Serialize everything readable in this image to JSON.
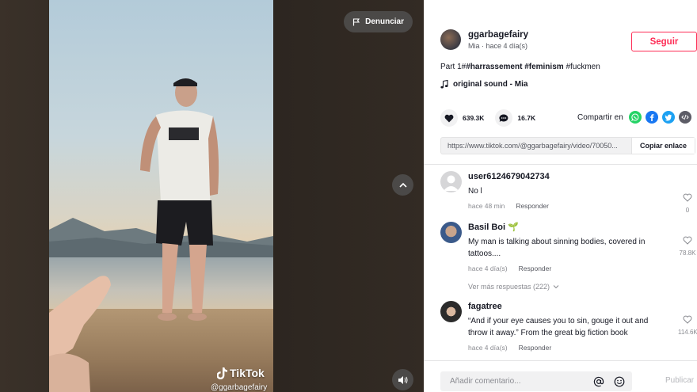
{
  "video": {
    "report_label": "Denunciar",
    "brand": "TikTok",
    "watermark_handle": "@ggarbagefairy",
    "player_icons": [
      "flag-icon",
      "chevron-up-icon",
      "volume-icon"
    ]
  },
  "author": {
    "username": "ggarbagefairy",
    "subtitle": "Mia · hace 4 día(s)",
    "follow_label": "Seguir"
  },
  "caption": {
    "prefix": "Part 1#",
    "tags_bold": [
      "#harrassement",
      "#feminism"
    ],
    "tag_plain": "#fuckmen"
  },
  "sound": {
    "label": "original sound - Mia"
  },
  "stats": {
    "likes": "639.3K",
    "comments": "16.7K",
    "share_label": "Compartir en",
    "share_icons": [
      "whatsapp-icon",
      "facebook-icon",
      "twitter-icon",
      "embed-icon"
    ],
    "colors": {
      "whatsapp": "#25d366",
      "facebook": "#1877f2",
      "twitter": "#1da1f2",
      "embed": "#5c5c66",
      "brand": "#fe2c55"
    }
  },
  "link": {
    "url": "https://www.tiktok.com/@ggarbagefairy/video/70050...",
    "copy_label": "Copiar enlace"
  },
  "comments": [
    {
      "user": "user6124679042734",
      "text": "No l",
      "time": "hace 48 min",
      "reply_label": "Responder",
      "likes": "0"
    },
    {
      "user": "Basil Boi",
      "emoji": "🌱",
      "text": "My man is talking about sinning bodies, covered in tattoos....",
      "time": "hace 4 día(s)",
      "reply_label": "Responder",
      "likes": "78.8K"
    },
    {
      "user": "fagatree",
      "text": "“And if your eye causes you to sin, gouge it out and throw it away.” From the great big fiction book",
      "time": "hace 4 día(s)",
      "reply_label": "Responder",
      "likes": "114.6K"
    }
  ],
  "more_replies": "Ver más respuestas (222)",
  "comment_input": {
    "placeholder": "Añadir comentario...",
    "post_label": "Publicar"
  }
}
